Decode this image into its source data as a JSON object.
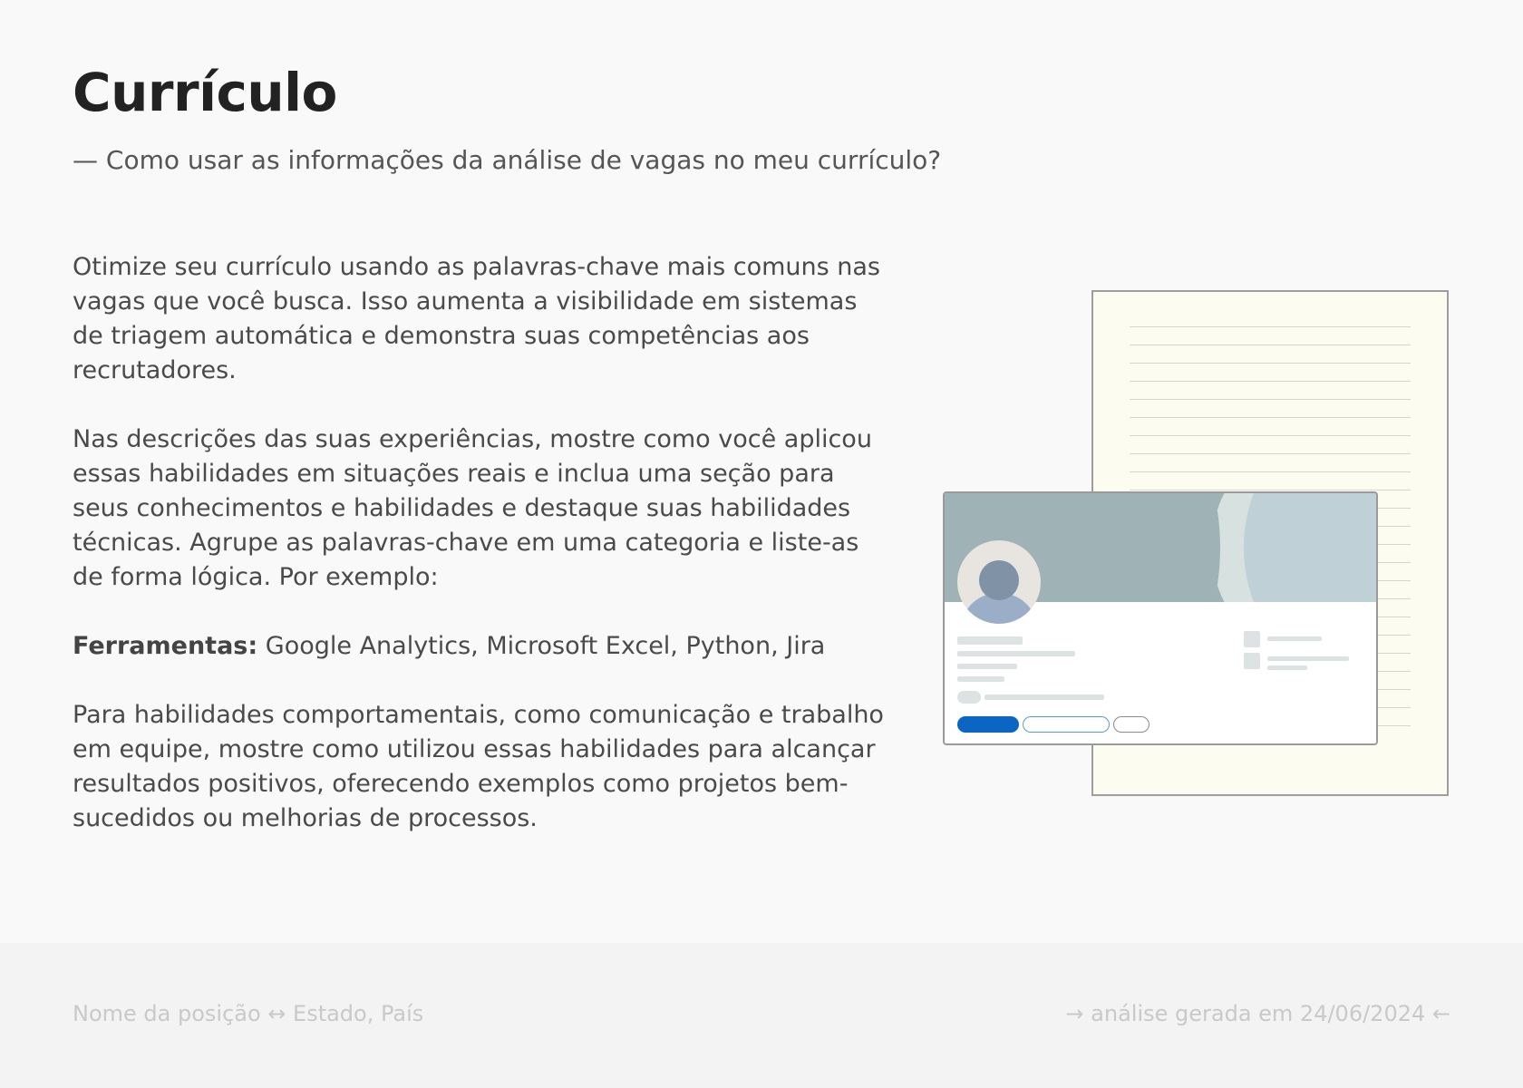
{
  "header": {
    "title": "Currículo",
    "subtitle": "— Como usar as informações da análise de vagas no meu currículo?"
  },
  "content": {
    "paragraph_1": "Otimize seu currículo usando as palavras-chave mais comuns nas vagas que você busca. Isso aumenta a visibilidade em sistemas de triagem automática e demonstra suas competências aos recrutadores.",
    "paragraph_2": "Nas descrições das suas experiências, mostre como você aplicou essas habilidades em situações reais e inclua uma seção para seus conhecimentos e habilidades e destaque suas habilidades técnicas. Agrupe as palavras-chave em uma categoria e liste-as de forma lógica. Por exemplo:",
    "tools_label": "Ferramentas:",
    "tools_list": " Google Analytics, Microsoft Excel, Python, Jira",
    "paragraph_3": "Para habilidades comportamentais, como comunicação e trabalho em equipe, mostre como utilizou essas habilidades para alcançar resultados positivos, oferecendo exemplos como projetos bem-sucedidos ou melhorias de processos."
  },
  "illustration": {
    "icon": "resume-and-profile-illustration",
    "colors": {
      "sheet": "#fdfcf0",
      "cover": "#9fb3b7",
      "primary_button": "#0a66c2"
    }
  },
  "footer": {
    "position_location": "Nome da posição ↔ Estado, País",
    "generated_date": "→ análise gerada em 24/06/2024 ←"
  }
}
